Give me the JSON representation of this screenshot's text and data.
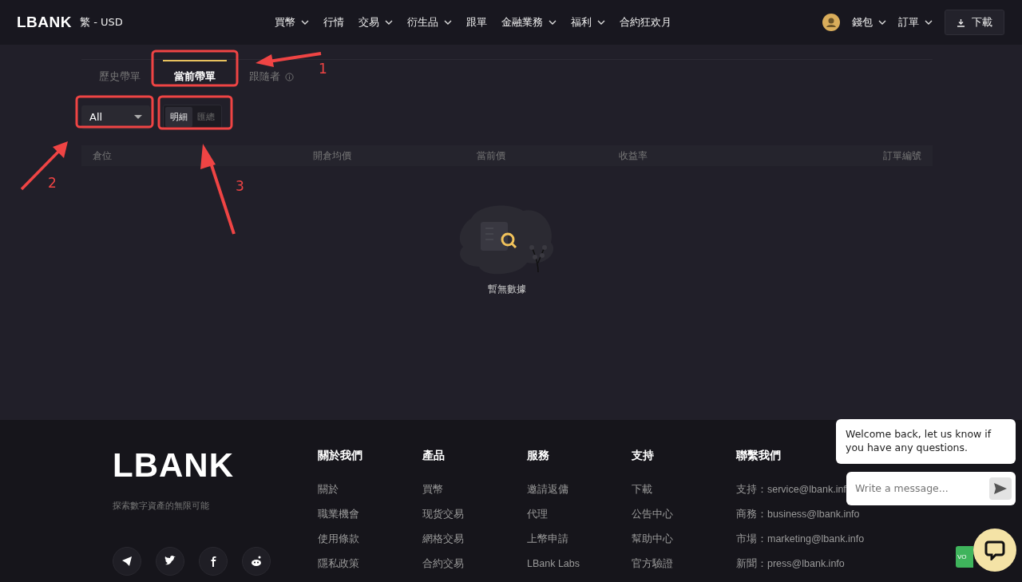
{
  "header": {
    "logo": "LBANK",
    "locale": "繁 - USD",
    "nav": [
      {
        "label": "買幣",
        "dropdown": true
      },
      {
        "label": "行情",
        "dropdown": false
      },
      {
        "label": "交易",
        "dropdown": true
      },
      {
        "label": "衍生品",
        "dropdown": true
      },
      {
        "label": "跟單",
        "dropdown": false
      },
      {
        "label": "金融業務",
        "dropdown": true
      },
      {
        "label": "福利",
        "dropdown": true
      },
      {
        "label": "合約狂欢月",
        "dropdown": false
      }
    ],
    "account": [
      {
        "label": "錢包",
        "dropdown": true
      },
      {
        "label": "訂單",
        "dropdown": true
      }
    ],
    "download": "下載"
  },
  "tabs": [
    {
      "label": "歷史帶單",
      "selected": false,
      "info": false
    },
    {
      "label": "當前帶單",
      "selected": true,
      "info": false
    },
    {
      "label": "跟隨者",
      "selected": false,
      "info": true
    }
  ],
  "filter": {
    "value": "All"
  },
  "view_toggle": [
    {
      "label": "明細",
      "selected": true
    },
    {
      "label": "匯總",
      "selected": false
    }
  ],
  "table": {
    "columns": [
      "倉位",
      "開倉均價",
      "當前價",
      "收益率",
      "訂單編號"
    ],
    "empty_text": "暫無數據"
  },
  "annotations": [
    {
      "label": "1"
    },
    {
      "label": "2"
    },
    {
      "label": "3"
    }
  ],
  "footer": {
    "logo": "LBANK",
    "tagline": "探索數字資產的無限可能",
    "columns": [
      {
        "heading": "關於我們",
        "links": [
          "關於",
          "職業機會",
          "使用條款",
          "隱私政策"
        ]
      },
      {
        "heading": "產品",
        "links": [
          "買幣",
          "现货交易",
          "網格交易",
          "合約交易"
        ]
      },
      {
        "heading": "服務",
        "links": [
          "邀請返傭",
          "代理",
          "上幣申請",
          "LBank Labs"
        ]
      },
      {
        "heading": "支持",
        "links": [
          "下載",
          "公告中心",
          "幫助中心",
          "官方驗證"
        ]
      },
      {
        "heading": "聯繫我們",
        "links": [
          "支持：service@lbank.inf",
          "商務：business@lbank.info",
          "市場：marketing@lbank.info",
          "新聞：press@lbank.info"
        ]
      }
    ]
  },
  "chat": {
    "message": "Welcome back, let us know if you have any questions.",
    "placeholder": "Write a message...",
    "side_button": "VO"
  }
}
